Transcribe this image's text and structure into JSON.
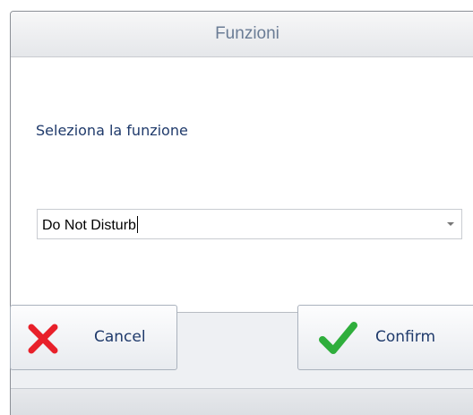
{
  "dialog": {
    "title": "Funzioni",
    "prompt": "Seleziona la funzione",
    "function_select": {
      "value": "Do Not Disturb",
      "icon": "chevron-down-icon"
    }
  },
  "buttons": {
    "cancel": {
      "label": "Cancel",
      "icon": "close-icon",
      "icon_color": "#e8202a"
    },
    "confirm": {
      "label": "Confirm",
      "icon": "checkmark-icon",
      "icon_color": "#2fae3c"
    }
  }
}
